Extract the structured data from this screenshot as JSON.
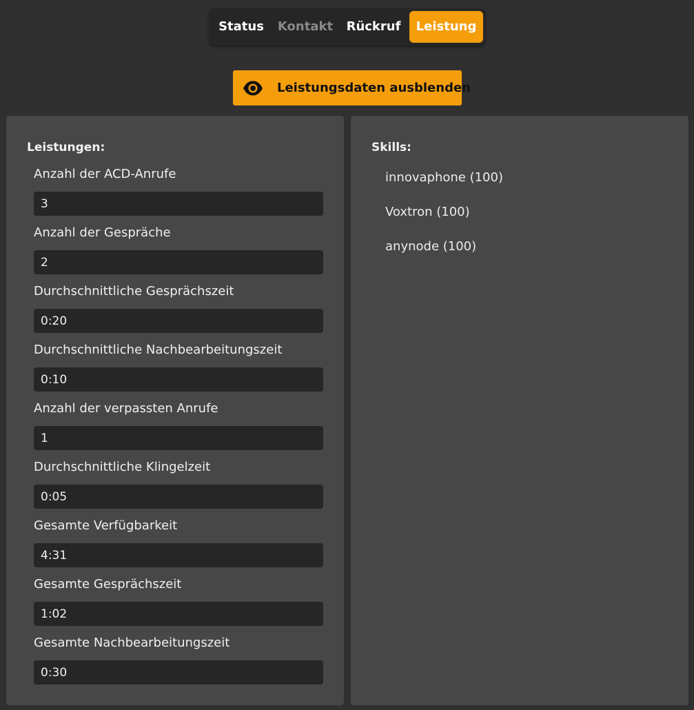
{
  "tabs": [
    {
      "label": "Status",
      "active": false
    },
    {
      "label": "Kontakt",
      "active": false
    },
    {
      "label": "Rückruf",
      "active": false
    },
    {
      "label": "Leistung",
      "active": true
    }
  ],
  "toggle": {
    "label": "Leistungsdaten ausblenden",
    "icon": "eye-icon"
  },
  "colors": {
    "accent": "#f59e0b",
    "background": "#303030",
    "panel": "#474747",
    "field": "#262626"
  },
  "performance": {
    "title": "Leistungen:",
    "metrics": [
      {
        "label": "Anzahl der ACD-Anrufe",
        "value": "3"
      },
      {
        "label": "Anzahl der Gespräche",
        "value": "2"
      },
      {
        "label": "Durchschnittliche Gesprächszeit",
        "value": "0:20"
      },
      {
        "label": "Durchschnittliche Nachbearbeitungszeit",
        "value": "0:10"
      },
      {
        "label": "Anzahl der verpassten Anrufe",
        "value": "1"
      },
      {
        "label": "Durchschnittliche Klingelzeit",
        "value": "0:05"
      },
      {
        "label": "Gesamte Verfügbarkeit",
        "value": "4:31"
      },
      {
        "label": "Gesamte Gesprächszeit",
        "value": "1:02"
      },
      {
        "label": "Gesamte Nachbearbeitungszeit",
        "value": "0:30"
      }
    ]
  },
  "skills": {
    "title": "Skills:",
    "items": [
      "innovaphone (100)",
      "Voxtron (100)",
      "anynode (100)"
    ]
  }
}
